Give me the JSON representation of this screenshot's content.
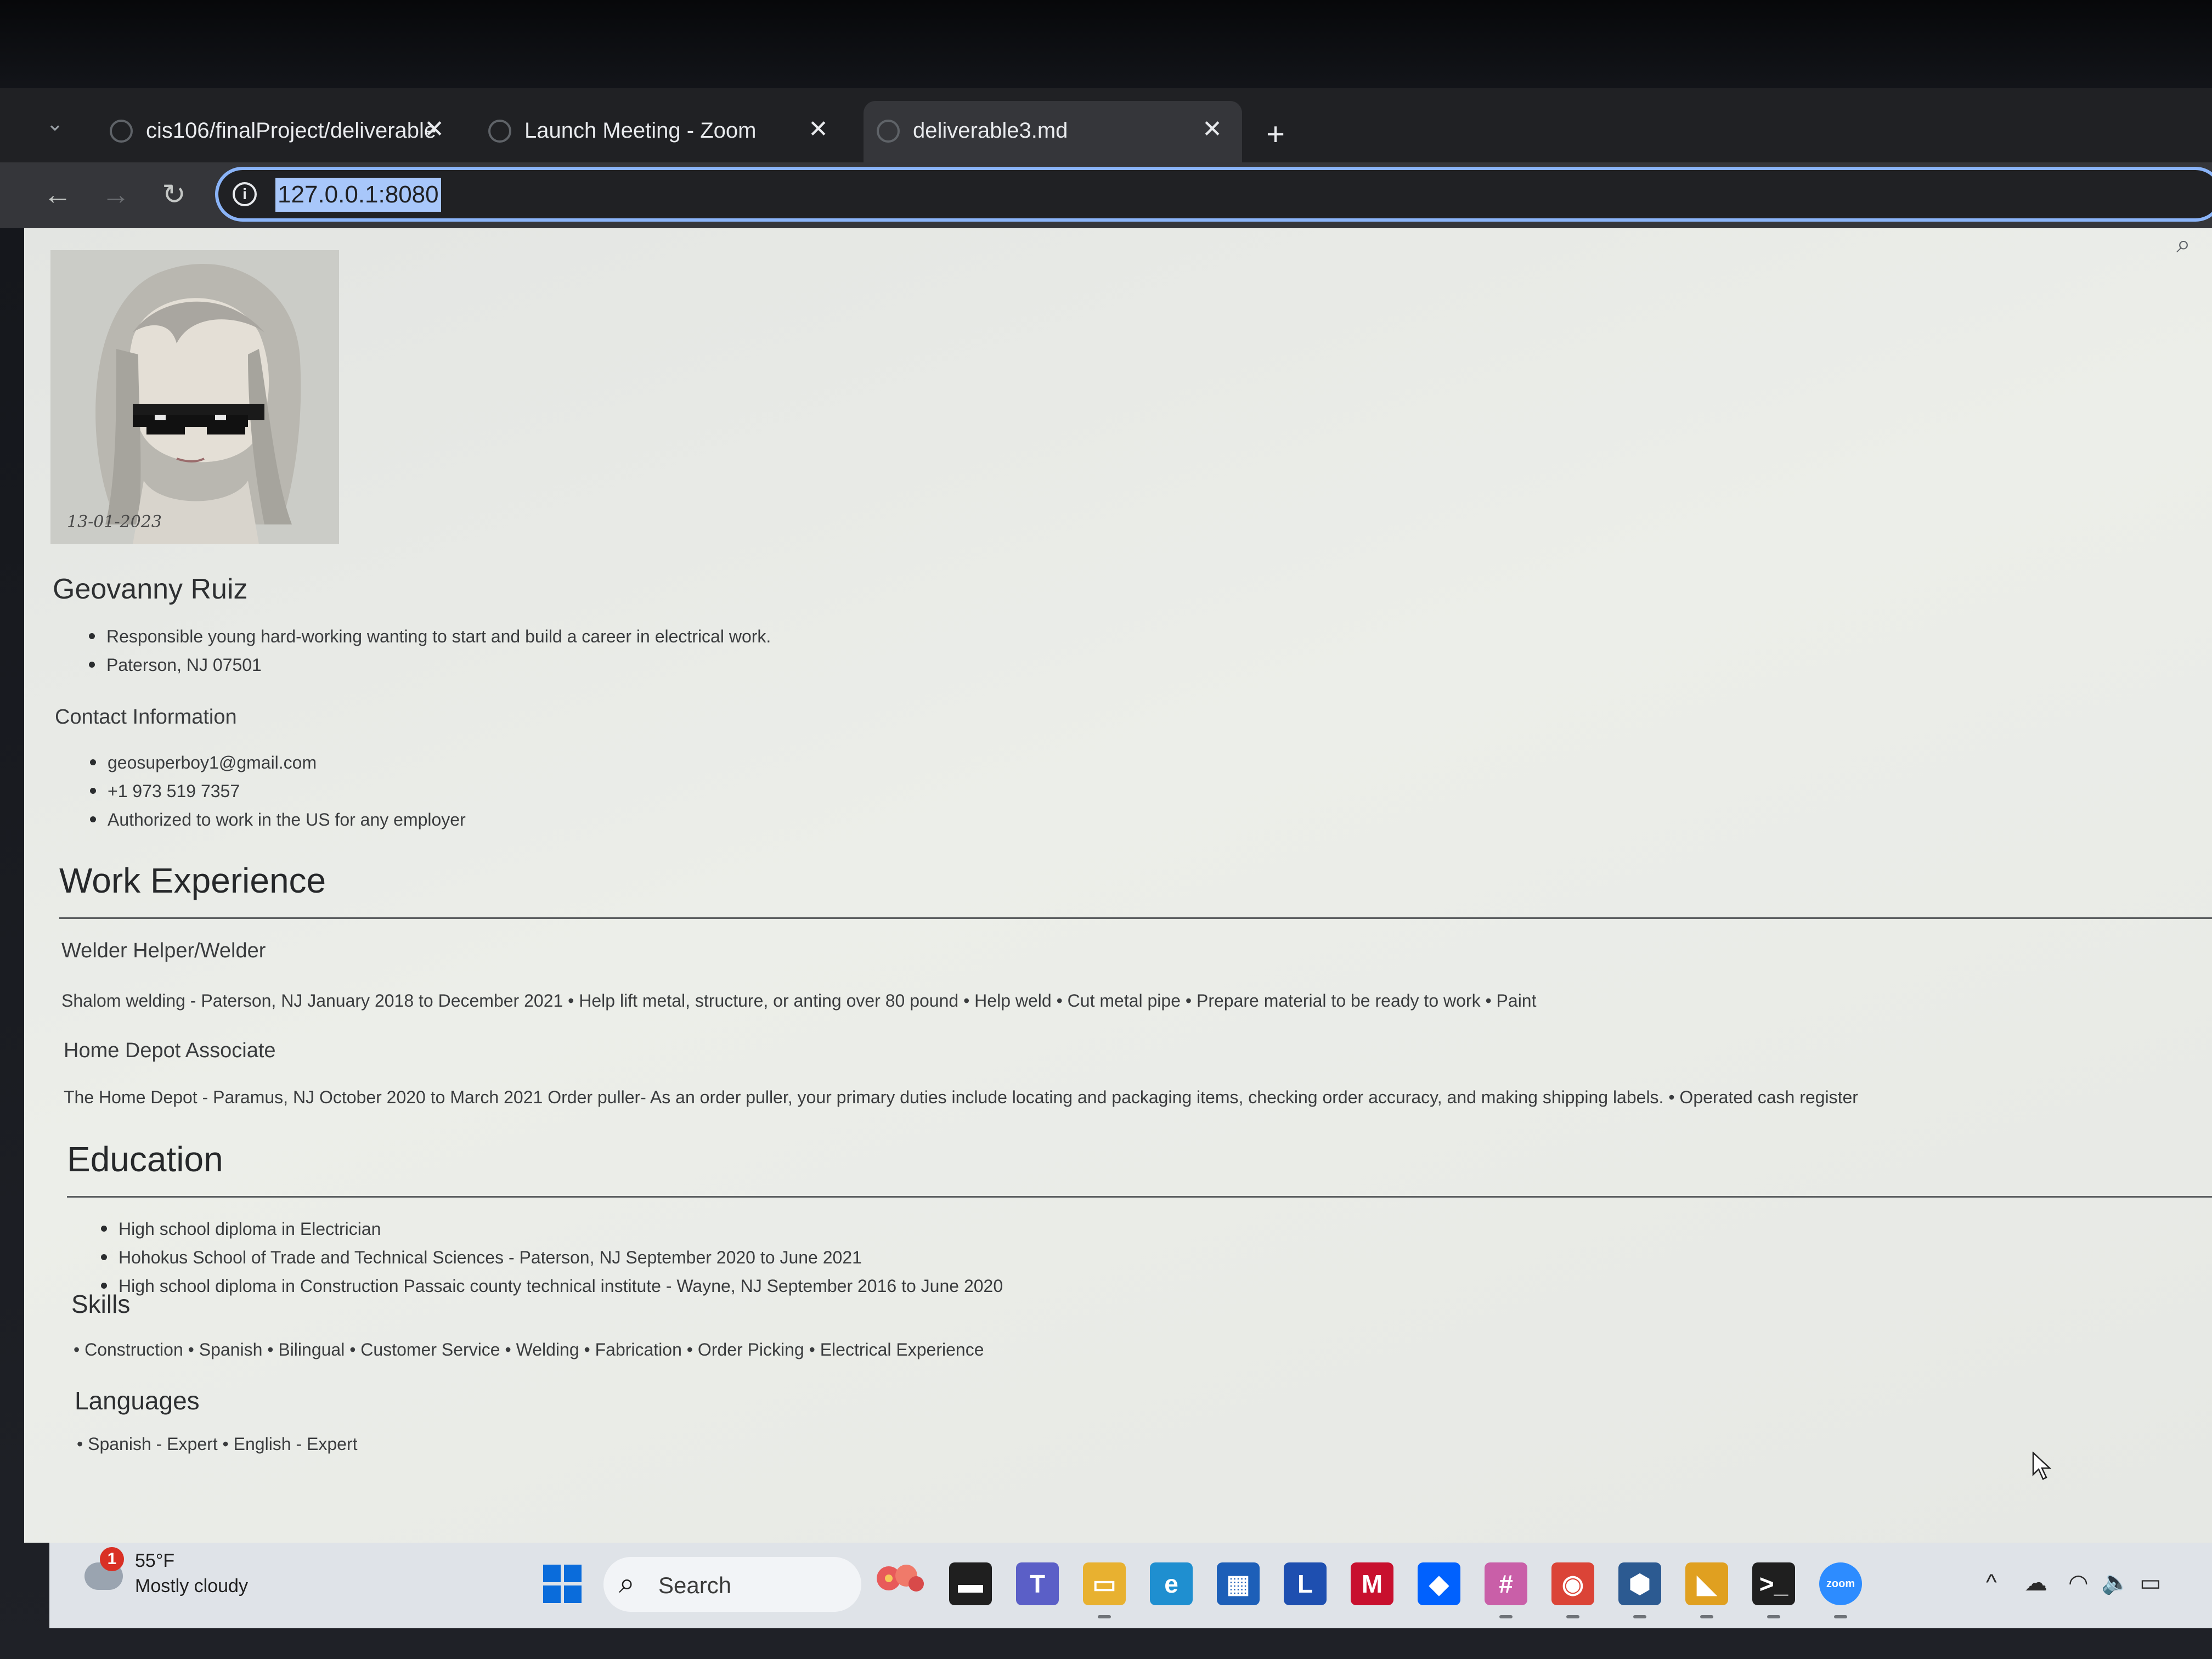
{
  "browser": {
    "tabs": [
      {
        "title": "cis106/finalProject/deliverable",
        "active": false
      },
      {
        "title": "Launch Meeting - Zoom",
        "active": false
      },
      {
        "title": "deliverable3.md",
        "active": true
      }
    ],
    "url": "127.0.0.1:8080",
    "icons": {
      "tab_menu": "chevron-down-icon",
      "tab_close": "close-icon",
      "new_tab": "plus-icon",
      "back": "back-arrow-icon",
      "forward": "forward-arrow-icon",
      "reload": "reload-icon",
      "site_info": "info-icon",
      "zoom": "magnifier-icon"
    },
    "glyphs": {
      "tab_menu": "⌄",
      "close": "✕",
      "new_tab": "+",
      "back": "←",
      "forward": "→",
      "reload": "↻",
      "info": "i",
      "zoom": "⌕"
    }
  },
  "resume": {
    "photo_caption": "13-01-2023",
    "name": "Geovanny Ruiz",
    "summary": [
      "Responsible young hard-working wanting to start and build a career in electrical work.",
      "Paterson, NJ 07501"
    ],
    "contact_heading": "Contact Information",
    "contact": [
      "geosuperboy1@gmail.com",
      "+1 973 519 7357",
      "Authorized to work in the US for any employer"
    ],
    "work_heading": "Work Experience",
    "jobs": [
      {
        "title": "Welder Helper/Welder",
        "description": "Shalom welding - Paterson, NJ January 2018 to December 2021 • Help lift metal, structure, or anting over 80 pound • Help weld • Cut metal pipe • Prepare material to be ready to work • Paint"
      },
      {
        "title": "Home Depot Associate",
        "description": "The Home Depot - Paramus, NJ October 2020 to March 2021 Order puller- As an order puller, your primary duties include locating and packaging items, checking order accuracy, and making shipping labels. • Operated cash register"
      }
    ],
    "education_heading": "Education",
    "education": [
      "High school diploma in Electrician",
      "Hohokus School of Trade and Technical Sciences - Paterson, NJ September 2020 to June 2021",
      "High school diploma in Construction Passaic county technical institute - Wayne, NJ September 2016 to June 2020"
    ],
    "skills_heading": "Skills",
    "skills_line": "• Construction • Spanish • Bilingual • Customer Service • Welding • Fabrication • Order Picking • Electrical Experience",
    "languages_heading": "Languages",
    "languages_line": "• Spanish - Expert • English - Expert"
  },
  "taskbar": {
    "weather": {
      "badge": "1",
      "temp": "55°F",
      "condition": "Mostly cloudy"
    },
    "search_label": "Search",
    "apps": [
      {
        "name": "task-view-icon",
        "glyph": "▬",
        "color": "#1f1f1f",
        "running": false
      },
      {
        "name": "teams-icon",
        "glyph": "T",
        "color": "#5b5fc7",
        "running": false
      },
      {
        "name": "file-explorer-icon",
        "glyph": "▭",
        "color": "#e8b130",
        "running": true
      },
      {
        "name": "edge-icon",
        "glyph": "e",
        "color": "#1f8fd0",
        "running": false
      },
      {
        "name": "store-icon",
        "glyph": "▦",
        "color": "#1d5fb8",
        "running": false
      },
      {
        "name": "l-app-icon",
        "glyph": "L",
        "color": "#1e4fb0",
        "running": false
      },
      {
        "name": "mcafee-icon",
        "glyph": "M",
        "color": "#c8102e",
        "running": false
      },
      {
        "name": "dropbox-icon",
        "glyph": "◆",
        "color": "#0061fe",
        "running": false
      },
      {
        "name": "slack-icon",
        "glyph": "#",
        "color": "#c95fa8",
        "running": true
      },
      {
        "name": "chrome-icon",
        "glyph": "◉",
        "color": "#db4437",
        "running": true
      },
      {
        "name": "virtualbox-icon",
        "glyph": "⬢",
        "color": "#2c5a91",
        "running": true
      },
      {
        "name": "vscode-icon",
        "glyph": "◣",
        "color": "#e0a020",
        "running": true
      },
      {
        "name": "terminal-icon",
        "glyph": ">_",
        "color": "#1f1f1f",
        "running": true
      },
      {
        "name": "zoom-icon",
        "glyph": "zoom",
        "color": "#2d8cff",
        "running": true
      }
    ],
    "tray_glyphs": [
      "^",
      "☁",
      "◠",
      "🔈",
      "▭"
    ]
  }
}
